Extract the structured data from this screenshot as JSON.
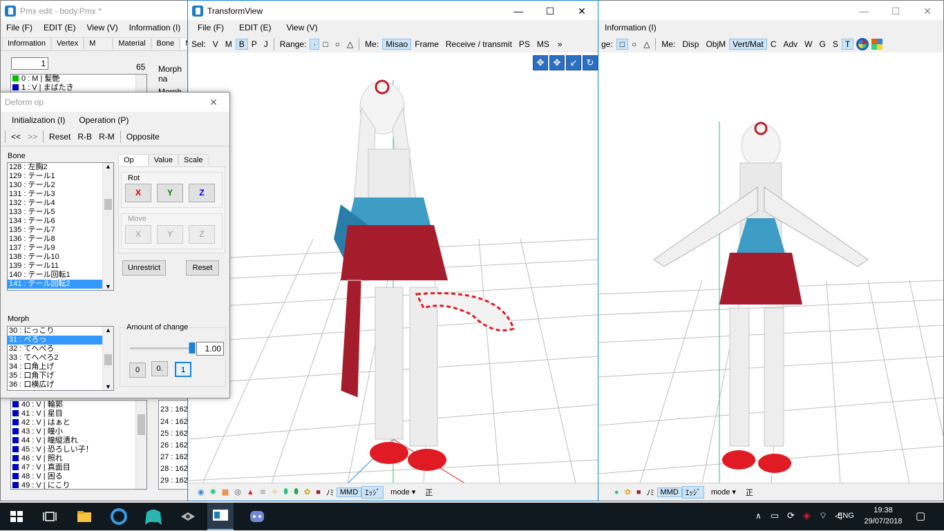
{
  "pmx": {
    "title": "Pmx edit - body.Pmx *",
    "menu": [
      "File (F)",
      "EDIT (E)",
      "View (V)",
      "Information (I)"
    ],
    "tabs": [
      "Information",
      "Vertex",
      "M",
      "Material",
      "Bone",
      "Morp"
    ],
    "index_value": "1",
    "count": "65",
    "morph_name_label": "Morph na",
    "morph_type_label": "Morph Ty",
    "top_list": [
      {
        "text": "0 : M | 髪艶",
        "color": "#00c000"
      },
      {
        "text": "1 : V | まばたき",
        "color": "#0000c0"
      }
    ],
    "bottom_list": [
      {
        "text": "40 : V | 輪郭",
        "color": "#0000c0"
      },
      {
        "text": "41 : V | 星目",
        "color": "#0000c0"
      },
      {
        "text": "42 : V | はぁと",
        "color": "#0000c0"
      },
      {
        "text": "43 : V | 瞳小",
        "color": "#0000c0"
      },
      {
        "text": "44 : V | 瞳縦潰れ",
        "color": "#0000c0"
      },
      {
        "text": "45 : V | 恐ろしい子！",
        "color": "#0000c0"
      },
      {
        "text": "46 : V | 照れ",
        "color": "#0000c0"
      },
      {
        "text": "47 : V | 真面目",
        "color": "#0000c0"
      },
      {
        "text": "48 : V | 困る",
        "color": "#0000c0"
      },
      {
        "text": "49 : V | にこり",
        "color": "#0000c0"
      }
    ],
    "offset_list": [
      "23 : 162",
      "24 : 162",
      "25 : 162",
      "26 : 162",
      "27 : 162",
      "28 : 162",
      "29 : 162"
    ]
  },
  "deform": {
    "title": "Deform op",
    "menu": [
      "Initialization (I)",
      "Operation (P)"
    ],
    "toolbar": [
      "<<",
      ">>",
      "Reset",
      "R-B",
      "R-M",
      "Opposite"
    ],
    "bone_label": "Bone",
    "bones": [
      "128 : 左胸2",
      "129 : テール1",
      "130 : テール2",
      "131 : テール3",
      "132 : テール4",
      "133 : テール5",
      "134 : テール6",
      "135 : テール7",
      "136 : テール8",
      "137 : テール9",
      "138 : テール10",
      "139 : テール11",
      "140 : テール回転1",
      "141 : テール回転2"
    ],
    "bone_selected": 13,
    "tabs": [
      "Op",
      "Value",
      "Scale"
    ],
    "rot_label": "Rot",
    "rot": [
      "X",
      "Y",
      "Z"
    ],
    "move_label": "Move",
    "move": [
      "X",
      "Y",
      "Z"
    ],
    "unrestrict": "Unrestrict",
    "reset": "Reset",
    "morph_label": "Morph",
    "morphs": [
      "30 : にっこり",
      "31 : ぺろっ",
      "32 : てへぺろ",
      "33 : てへぺろ2",
      "34 : 口角上げ",
      "35 : 口角下げ",
      "36 : 口横広げ"
    ],
    "morph_selected": 1,
    "amount_label": "Amount of change",
    "amount_value": "1.00",
    "amount_level": 1.0,
    "presets": [
      "0",
      "0.",
      "1"
    ]
  },
  "transform": {
    "title": "TransformView",
    "menu": [
      "File (F)",
      "EDIT (E)",
      "View (V)"
    ],
    "toolbar": [
      "Sel:",
      "V",
      "M",
      "B",
      "P",
      "J",
      "Range:",
      "·",
      "□",
      "○",
      "△",
      "Me:",
      "Misao",
      "Frame",
      "Receive / transmit",
      "PS",
      "MS"
    ],
    "toolbar_on": [
      "B",
      "·",
      "Misao"
    ],
    "more": "»",
    "bottom": [
      "ﾉﾐ",
      "MMD",
      "ｴｯｼﾞ",
      "mode ▾",
      "正"
    ]
  },
  "right": {
    "menu": [
      "Information (I)"
    ],
    "toolbar": [
      "ge:",
      "□",
      "○",
      "△",
      "Me:",
      "Disp",
      "ObjM",
      "Vert/Mat",
      "C",
      "Adv",
      "W",
      "G",
      "S",
      "T"
    ],
    "toolbar_on": [
      "□",
      "Vert/Mat",
      "T"
    ],
    "bottom": [
      "ﾉﾐ",
      "MMD",
      "ｴｯｼﾞ",
      "mode ▾",
      "正"
    ]
  },
  "taskbar": {
    "lang": "ENG",
    "time": "19:38",
    "date": "29/07/2018"
  },
  "colors": {
    "rot_x": "#d00000",
    "rot_y": "#008000",
    "rot_z": "#0000d0",
    "accent": "#3399ff"
  }
}
